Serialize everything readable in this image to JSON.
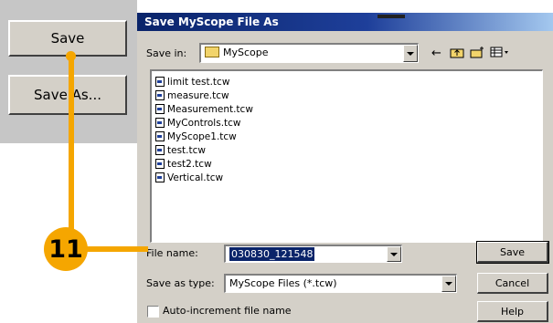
{
  "left_panel": {
    "save_label": "Save",
    "save_as_label": "Save As..."
  },
  "dialog": {
    "title": "Save MyScope File As",
    "save_in_label": "Save in:",
    "save_in_value": "MyScope",
    "toolbar_icons": [
      "back-arrow-icon",
      "up-folder-icon",
      "new-folder-icon",
      "view-menu-icon"
    ],
    "files": [
      "limit test.tcw",
      "measure.tcw",
      "Measurement.tcw",
      "MyControls.tcw",
      "MyScope1.tcw",
      "test.tcw",
      "test2.tcw",
      "Vertical.tcw"
    ],
    "file_name_label": "File name:",
    "file_name_value": "030830_121548",
    "save_type_label": "Save as type:",
    "save_type_value": "MyScope Files (*.tcw)",
    "autoincrement_label": "Auto-increment file name",
    "autoincrement_checked": false,
    "save_button": "Save",
    "cancel_button": "Cancel",
    "help_button": "Help"
  },
  "callout": {
    "step_number": "11",
    "color": "#f5a600"
  }
}
